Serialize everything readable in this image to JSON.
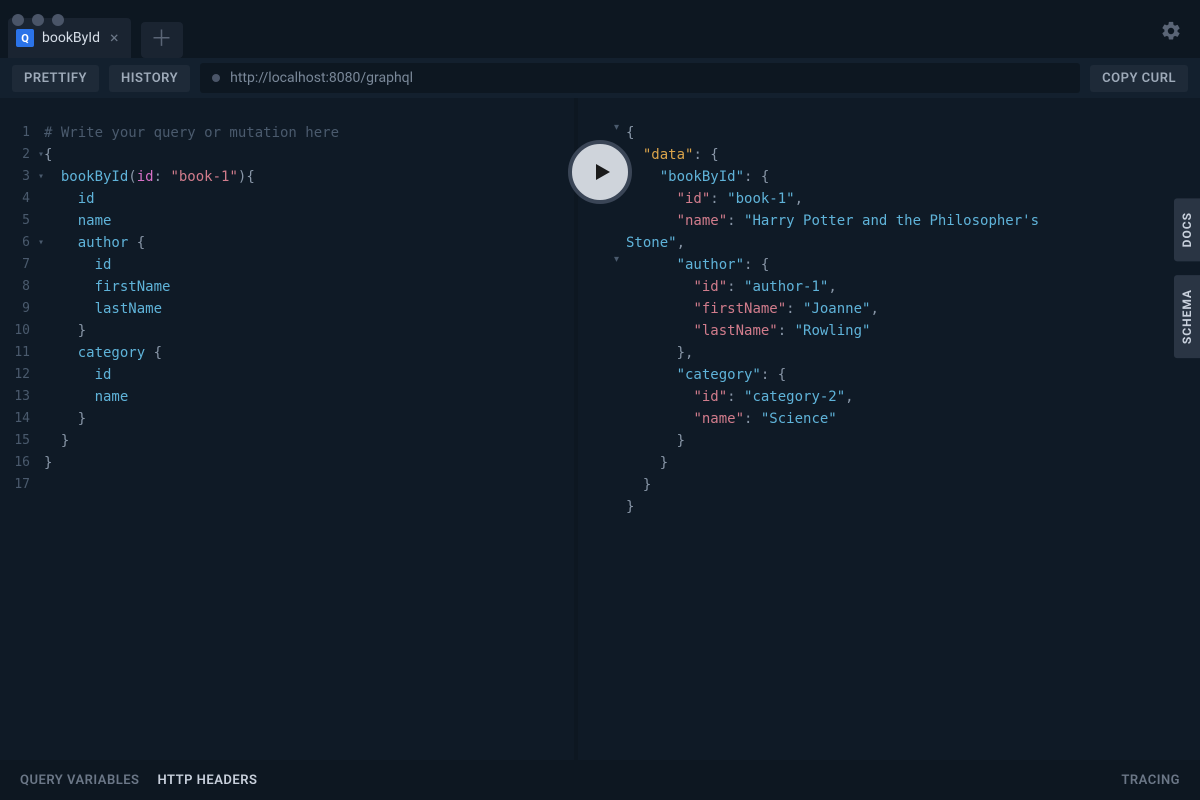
{
  "window": {
    "tab_icon_letter": "Q",
    "tab_title": "bookById"
  },
  "toolbar": {
    "prettify": "PRETTIFY",
    "history": "HISTORY",
    "endpoint": "http://localhost:8080/graphql",
    "copy_curl": "COPY CURL"
  },
  "editor": {
    "placeholder_comment": "# Write your query or mutation here",
    "lines": [
      {
        "n": 1,
        "fold": false
      },
      {
        "n": 2,
        "fold": true
      },
      {
        "n": 3,
        "fold": true
      },
      {
        "n": 4,
        "fold": false
      },
      {
        "n": 5,
        "fold": false
      },
      {
        "n": 6,
        "fold": true
      },
      {
        "n": 7,
        "fold": false
      },
      {
        "n": 8,
        "fold": false
      },
      {
        "n": 9,
        "fold": false
      },
      {
        "n": 10,
        "fold": false
      },
      {
        "n": 11,
        "fold": false
      },
      {
        "n": 12,
        "fold": false
      },
      {
        "n": 13,
        "fold": false
      },
      {
        "n": 14,
        "fold": false
      },
      {
        "n": 15,
        "fold": false
      },
      {
        "n": 16,
        "fold": false
      },
      {
        "n": 17,
        "fold": false
      }
    ],
    "query": {
      "root": "bookById",
      "arg_name": "id",
      "arg_value": "\"book-1\"",
      "fields": {
        "id": "id",
        "name": "name",
        "author": "author",
        "author_id": "id",
        "author_firstName": "firstName",
        "author_lastName": "lastName",
        "category": "category",
        "category_id": "id",
        "category_name": "name"
      }
    }
  },
  "result": {
    "data_key": "\"data\"",
    "bookById_key": "\"bookById\"",
    "id_key": "\"id\"",
    "id_val": "\"book-1\"",
    "name_key": "\"name\"",
    "name_val": "\"Harry Potter and the Philosopher's Stone\"",
    "author_key": "\"author\"",
    "author_id_key": "\"id\"",
    "author_id_val": "\"author-1\"",
    "author_fn_key": "\"firstName\"",
    "author_fn_val": "\"Joanne\"",
    "author_ln_key": "\"lastName\"",
    "author_ln_val": "\"Rowling\"",
    "category_key": "\"category\"",
    "category_id_key": "\"id\"",
    "category_id_val": "\"category-2\"",
    "category_name_key": "\"name\"",
    "category_name_val": "\"Science\""
  },
  "rail": {
    "docs": "DOCS",
    "schema": "SCHEMA"
  },
  "footer": {
    "query_vars": "QUERY VARIABLES",
    "http_headers": "HTTP HEADERS",
    "tracing": "TRACING"
  }
}
